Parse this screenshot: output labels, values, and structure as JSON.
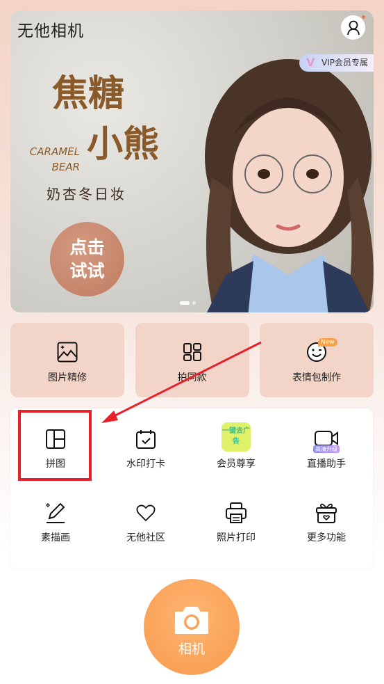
{
  "header": {
    "app_title": "无他相机",
    "vip_label": "VIP会员专属"
  },
  "banner": {
    "title_line1": "焦糖",
    "title_line2": "小熊",
    "english": "CARAMEL BEAR",
    "subtitle": "奶杏冬日妆",
    "cta": "点击试试",
    "pages": 2,
    "current_page": 1
  },
  "feature_cards": [
    {
      "label": "图片精修",
      "icon": "image-icon"
    },
    {
      "label": "拍同款",
      "icon": "layout-grid-icon"
    },
    {
      "label": "表情包制作",
      "icon": "smiley-icon",
      "badge": "New"
    }
  ],
  "tools": [
    {
      "label": "拼图",
      "icon": "collage-icon"
    },
    {
      "label": "水印打卡",
      "icon": "calendar-check-icon"
    },
    {
      "label": "会员尊享",
      "icon": "remove-ads-icon",
      "icon_text": "一键去广告"
    },
    {
      "label": "直播助手",
      "icon": "video-camera-icon",
      "badge": "高清升级"
    },
    {
      "label": "素描画",
      "icon": "pencil-icon"
    },
    {
      "label": "无他社区",
      "icon": "heart-icon"
    },
    {
      "label": "照片打印",
      "icon": "printer-icon"
    },
    {
      "label": "更多功能",
      "icon": "gift-icon"
    }
  ],
  "camera_button": {
    "label": "相机",
    "icon": "camera-icon"
  },
  "annotation": {
    "highlight_color": "#e8202a",
    "target": "拼图"
  },
  "colors": {
    "accent": "#f79a4c",
    "card_bg": "#f2d5c8"
  }
}
